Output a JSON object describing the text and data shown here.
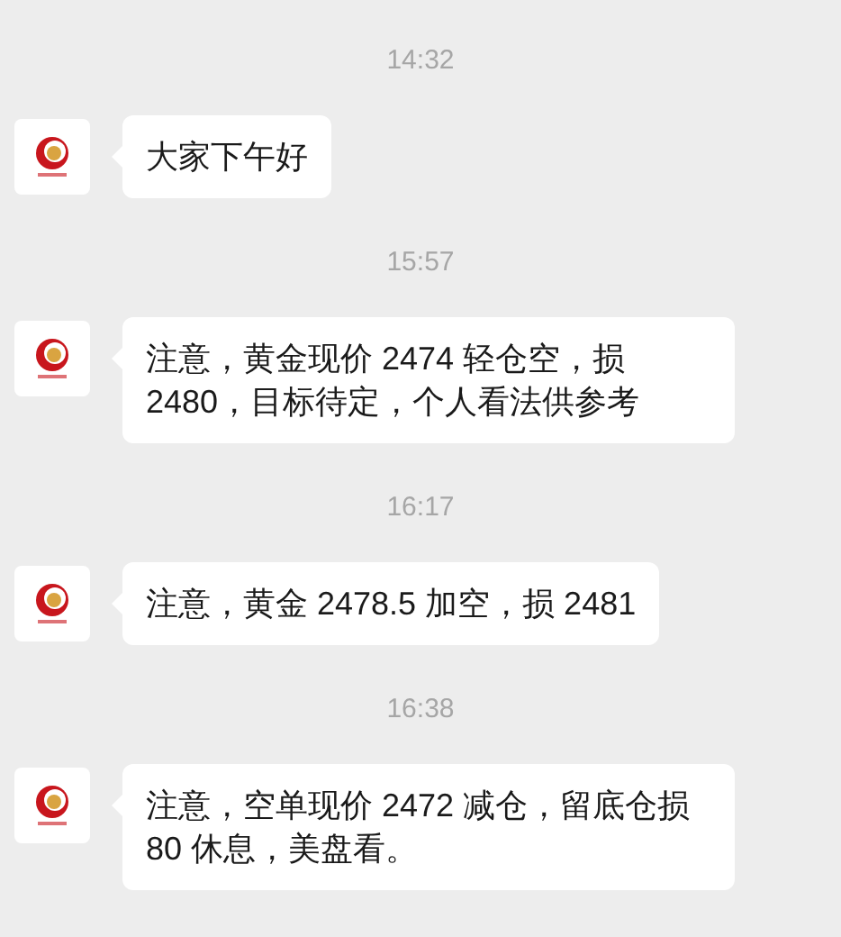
{
  "messages": [
    {
      "time": "14:32",
      "text": "大家下午好"
    },
    {
      "time": "15:57",
      "text": "注意，黄金现价 2474 轻仓空，损 2480，目标待定，个人看法供参考"
    },
    {
      "time": "16:17",
      "text": "注意，黄金 2478.5 加空，损 2481"
    },
    {
      "time": "16:38",
      "text": "注意，空单现价 2472 减仓，留底仓损 80 休息，美盘看。"
    }
  ]
}
